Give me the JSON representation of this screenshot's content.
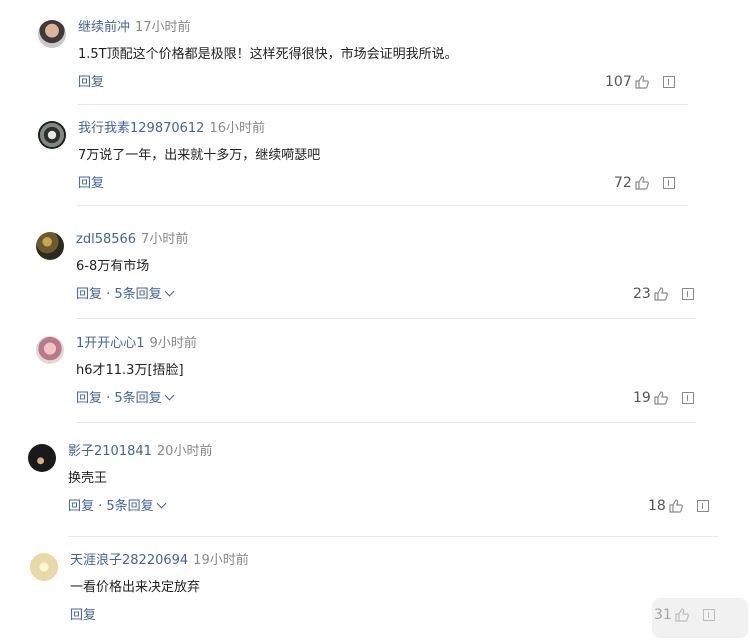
{
  "comments": [
    {
      "user": "继续前冲",
      "time": "17小时前",
      "text": "1.5T顶配这个价格都是极限！这样死得很快，市场会证明我所说。",
      "reply_label": "回复",
      "sub_replies": "",
      "likes": "107"
    },
    {
      "user": "我行我素129870612",
      "time": "16小时前",
      "text": "7万说了一年，出来就十多万，继续嗬瑟吧",
      "reply_label": "回复",
      "sub_replies": "",
      "likes": "72"
    },
    {
      "user": "zdl58566",
      "time": "7小时前",
      "text": "6-8万有市场",
      "reply_label": "回复",
      "sub_replies": " · 5条回复",
      "likes": "23"
    },
    {
      "user": "1开开心心1",
      "time": "9小时前",
      "text": "h6才11.3万[捂脸]",
      "reply_label": "回复",
      "sub_replies": " · 5条回复",
      "likes": "19"
    },
    {
      "user": "影子2101841",
      "time": "20小时前",
      "text": "换壳王",
      "reply_label": "回复",
      "sub_replies": " · 5条回复",
      "likes": "18"
    },
    {
      "user": "天涯浪子28220694",
      "time": "19小时前",
      "text": "一看价格出来决定放弃",
      "reply_label": "回复",
      "sub_replies": "",
      "likes": "31"
    }
  ],
  "colors": {
    "link": "#406599",
    "text": "#222222",
    "meta": "#888888",
    "divider": "#e8e8e8"
  },
  "icons": [
    "thumb-up-icon",
    "report-icon",
    "chevron-down-icon"
  ]
}
